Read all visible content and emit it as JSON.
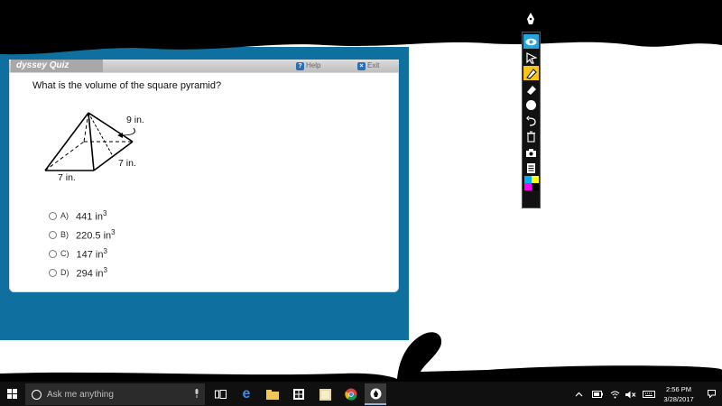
{
  "quiz": {
    "title": "dyssey Quiz",
    "help_label": "Help",
    "exit_label": "Exit",
    "question": "What is the volume of the square pyramid?",
    "figure": {
      "slant_label": "9 in.",
      "side_label": "7 in.",
      "base_label": "7 in."
    },
    "choices": [
      {
        "letter": "A)",
        "value": "441 in",
        "exp": "3"
      },
      {
        "letter": "B)",
        "value": "220.5 in",
        "exp": "3"
      },
      {
        "letter": "C)",
        "value": "147 in",
        "exp": "3"
      },
      {
        "letter": "D)",
        "value": "294 in",
        "exp": "3"
      }
    ]
  },
  "annotation_toolbar": {
    "tools": [
      "eye-icon",
      "cursor-icon",
      "highlighter-icon",
      "eraser-icon",
      "pen-size-icon",
      "undo-icon",
      "trash-icon",
      "camera-icon",
      "notes-icon",
      "color-palette-icon"
    ],
    "colors": [
      "#00b0f0",
      "#ffff00",
      "#ff00ff",
      "#000000"
    ]
  },
  "taskbar": {
    "search_placeholder": "Ask me anything",
    "apps": [
      "task-view-icon",
      "edge-icon",
      "file-explorer-icon",
      "store-icon",
      "notes-app-icon",
      "chrome-icon",
      "pen-app-icon"
    ],
    "clock_time": "2:56 PM",
    "clock_date": "3/28/2017"
  }
}
